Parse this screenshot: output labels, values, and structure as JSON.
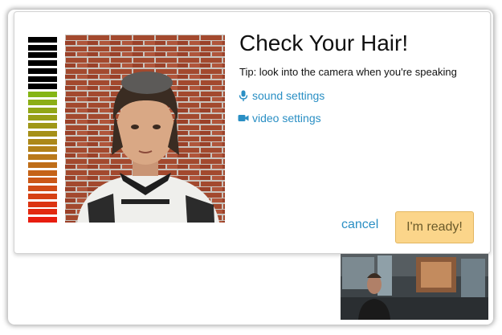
{
  "dialog": {
    "title": "Check Your Hair!",
    "tip": "Tip: look into the camera when you're speaking",
    "sound_link": "sound settings",
    "video_link": "video settings",
    "cancel_label": "cancel",
    "ready_label": "I'm ready!"
  },
  "icons": {
    "sound": "microphone-icon",
    "video": "video-camera-icon"
  },
  "colors": {
    "link": "#2a8fc4",
    "ready_button": "#fbd58a",
    "meter_low": "#e81d0f",
    "meter_mid": "#b9791a",
    "meter_high": "#84b515",
    "meter_idle": "#000000"
  },
  "mic_level": 0.7
}
